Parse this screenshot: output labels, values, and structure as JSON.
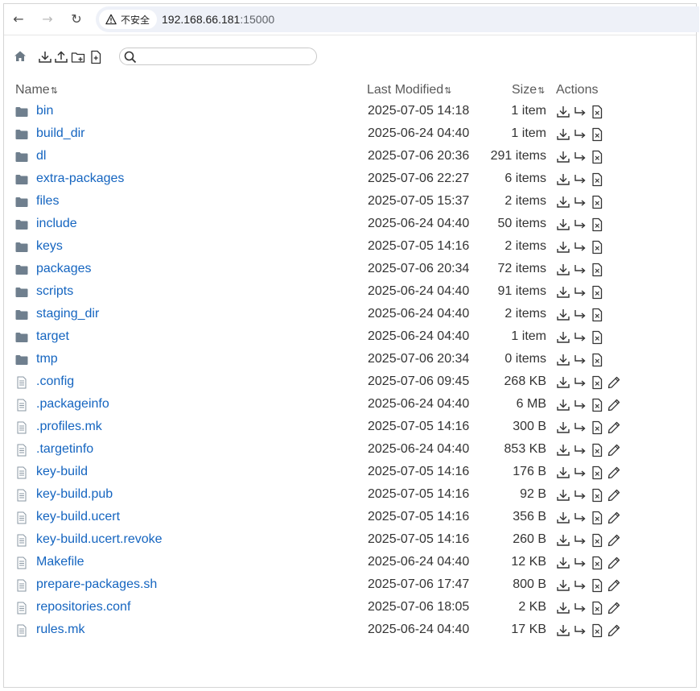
{
  "browser": {
    "security_label": "不安全",
    "url_host": "192.168.66.181",
    "url_port": ":15000"
  },
  "toolbar": {
    "search_placeholder": ""
  },
  "header": {
    "name": "Name",
    "modified": "Last Modified",
    "size": "Size",
    "actions": "Actions"
  },
  "files": [
    {
      "name": "bin",
      "type": "folder",
      "modified": "2025-07-05 14:18",
      "size": "1 item"
    },
    {
      "name": "build_dir",
      "type": "folder",
      "modified": "2025-06-24 04:40",
      "size": "1 item"
    },
    {
      "name": "dl",
      "type": "folder",
      "modified": "2025-07-06 20:36",
      "size": "291 items"
    },
    {
      "name": "extra-packages",
      "type": "folder",
      "modified": "2025-07-06 22:27",
      "size": "6 items"
    },
    {
      "name": "files",
      "type": "folder",
      "modified": "2025-07-05 15:37",
      "size": "2 items"
    },
    {
      "name": "include",
      "type": "folder",
      "modified": "2025-06-24 04:40",
      "size": "50 items"
    },
    {
      "name": "keys",
      "type": "folder",
      "modified": "2025-07-05 14:16",
      "size": "2 items"
    },
    {
      "name": "packages",
      "type": "folder",
      "modified": "2025-07-06 20:34",
      "size": "72 items"
    },
    {
      "name": "scripts",
      "type": "folder",
      "modified": "2025-06-24 04:40",
      "size": "91 items"
    },
    {
      "name": "staging_dir",
      "type": "folder",
      "modified": "2025-06-24 04:40",
      "size": "2 items"
    },
    {
      "name": "target",
      "type": "folder",
      "modified": "2025-06-24 04:40",
      "size": "1 item"
    },
    {
      "name": "tmp",
      "type": "folder",
      "modified": "2025-07-06 20:34",
      "size": "0 items"
    },
    {
      "name": ".config",
      "type": "file",
      "modified": "2025-07-06 09:45",
      "size": "268 KB"
    },
    {
      "name": ".packageinfo",
      "type": "file",
      "modified": "2025-06-24 04:40",
      "size": "6 MB"
    },
    {
      "name": ".profiles.mk",
      "type": "file",
      "modified": "2025-07-05 14:16",
      "size": "300 B"
    },
    {
      "name": ".targetinfo",
      "type": "file",
      "modified": "2025-06-24 04:40",
      "size": "853 KB"
    },
    {
      "name": "key-build",
      "type": "file",
      "modified": "2025-07-05 14:16",
      "size": "176 B"
    },
    {
      "name": "key-build.pub",
      "type": "file",
      "modified": "2025-07-05 14:16",
      "size": "92 B"
    },
    {
      "name": "key-build.ucert",
      "type": "file",
      "modified": "2025-07-05 14:16",
      "size": "356 B"
    },
    {
      "name": "key-build.ucert.revoke",
      "type": "file",
      "modified": "2025-07-05 14:16",
      "size": "260 B"
    },
    {
      "name": "Makefile",
      "type": "file",
      "modified": "2025-06-24 04:40",
      "size": "12 KB"
    },
    {
      "name": "prepare-packages.sh",
      "type": "file",
      "modified": "2025-07-06 17:47",
      "size": "800 B"
    },
    {
      "name": "repositories.conf",
      "type": "file",
      "modified": "2025-07-06 18:05",
      "size": "2 KB"
    },
    {
      "name": "rules.mk",
      "type": "file",
      "modified": "2025-06-24 04:40",
      "size": "17 KB"
    }
  ]
}
